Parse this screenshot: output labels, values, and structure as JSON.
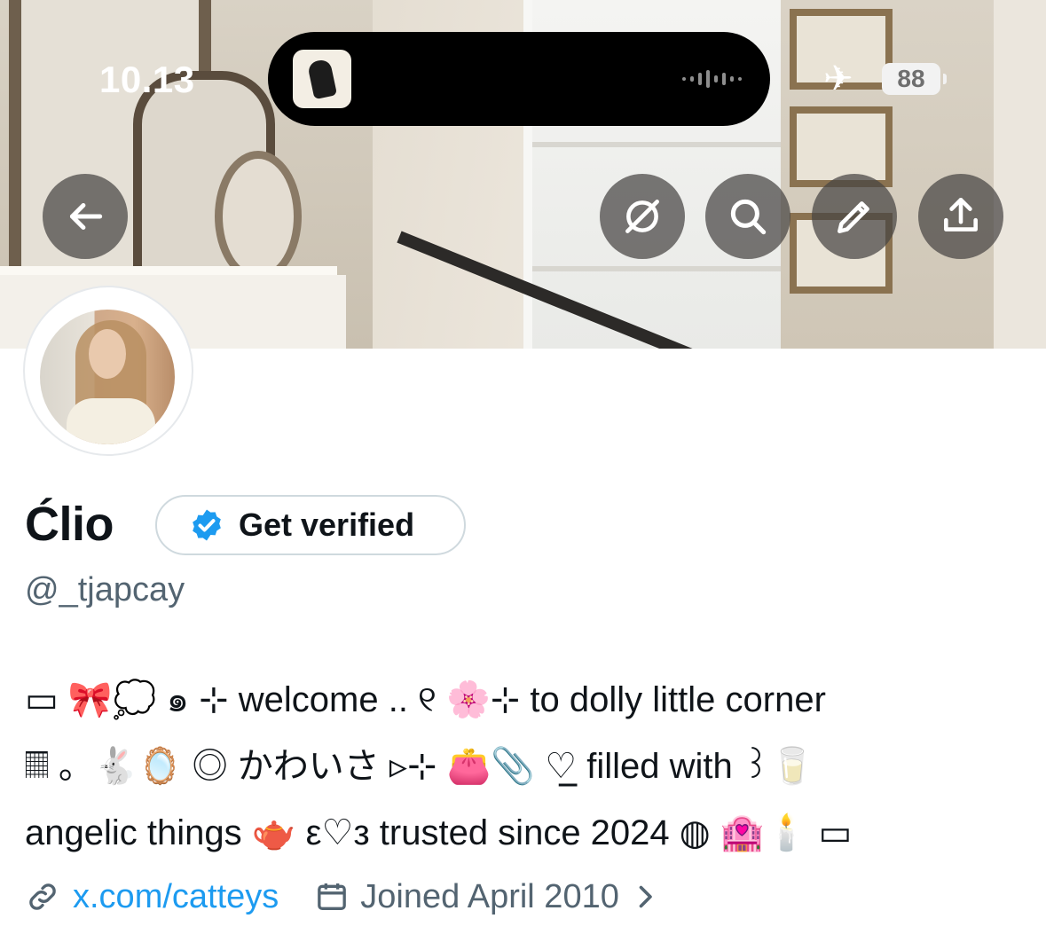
{
  "status_bar": {
    "time": "10.13",
    "battery": "88",
    "airplane_icon": "airplane-icon"
  },
  "header_actions": {
    "back": "back-arrow-icon",
    "grok": "grok-icon",
    "search": "search-icon",
    "edit": "pencil-icon",
    "share": "share-icon"
  },
  "profile": {
    "display_name": "Ćlio",
    "verify_label": "Get verified",
    "handle": "@_tjapcay",
    "bio_lines": [
      "▭ 🎀💭 ๑ ⊹ welcome .. ୧ 🌸⊹ to dolly little corner",
      "𝄜 。🐇🪞 ◎ かわいさ ▹⊹ 👛📎 ♡̲ filled with ꒱🥛",
      "angelic things 🫖 ε♡з trusted since 2024 ◍ 🏩🕯️ ▭"
    ],
    "website": "x.com/catteys",
    "joined": "Joined April 2010"
  },
  "colors": {
    "link": "#1d9bf0",
    "secondary_text": "#536471",
    "primary_text": "#0f1419",
    "verify_badge": "#1d9bf0"
  }
}
